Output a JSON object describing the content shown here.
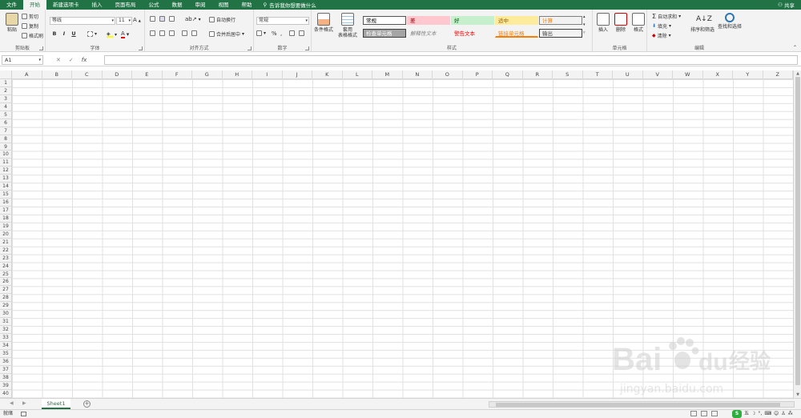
{
  "tabs": [
    "文件",
    "开始",
    "新建选项卡",
    "插入",
    "页面布局",
    "公式",
    "数据",
    "审阅",
    "视图",
    "帮助"
  ],
  "active_tab": "开始",
  "tellme": "告诉我你想要做什么",
  "share": "共享",
  "clipboard": {
    "paste": "粘贴",
    "cut": "剪切",
    "copy": "复制",
    "painter": "格式刷",
    "label": "剪贴板"
  },
  "font": {
    "name": "等线",
    "size": "11",
    "bold": "B",
    "italic": "I",
    "underline": "U",
    "label": "字体"
  },
  "alignment": {
    "wrap": "自动换行",
    "merge": "合并后居中",
    "label": "对齐方式"
  },
  "number": {
    "format": "常规",
    "percent": "%",
    "label": "数字"
  },
  "styles": {
    "conditional": "条件格式",
    "table": "套用\n表格格式",
    "cells": [
      {
        "text": "常规",
        "bg": "#ffffff",
        "fg": "#000000",
        "border": "#555555"
      },
      {
        "text": "差",
        "bg": "#ffc7ce",
        "fg": "#9c0006",
        "border": "#ffc7ce"
      },
      {
        "text": "好",
        "bg": "#c6efce",
        "fg": "#006100",
        "border": "#c6efce"
      },
      {
        "text": "适中",
        "bg": "#ffeb9c",
        "fg": "#9c5700",
        "border": "#ffeb9c"
      },
      {
        "text": "计算",
        "bg": "#f2f2f2",
        "fg": "#fa7d00",
        "border": "#7f7f7f"
      },
      {
        "text": "检查单元格",
        "bg": "#a5a5a5",
        "fg": "#ffffff",
        "border": "#3f3f3f"
      },
      {
        "text": "解释性文本",
        "bg": "#f3f3f3",
        "fg": "#7f7f7f",
        "border": "#f3f3f3"
      },
      {
        "text": "警告文本",
        "bg": "#f3f3f3",
        "fg": "#ff0000",
        "border": "#f3f3f3"
      },
      {
        "text": "链接单元格",
        "bg": "#f3f3f3",
        "fg": "#fa7d00",
        "border": "#f3f3f3"
      },
      {
        "text": "输出",
        "bg": "#f2f2f2",
        "fg": "#3f3f3f",
        "border": "#3f3f3f"
      }
    ],
    "label": "样式"
  },
  "cells_group": {
    "insert": "插入",
    "delete": "删除",
    "format": "格式",
    "label": "单元格"
  },
  "editing": {
    "autosum": "自动求和",
    "fill": "填充",
    "clear": "清除",
    "sort": "排序和筛选",
    "find": "查找和选择",
    "label": "编辑"
  },
  "namebox": "A1",
  "fx": "fx",
  "columns": [
    "A",
    "B",
    "C",
    "D",
    "E",
    "F",
    "G",
    "H",
    "I",
    "J",
    "K",
    "L",
    "M",
    "N",
    "O",
    "P",
    "Q",
    "R",
    "S",
    "T",
    "U",
    "V",
    "W",
    "X",
    "Y",
    "Z"
  ],
  "rows": [
    1,
    2,
    3,
    4,
    5,
    6,
    7,
    8,
    9,
    10,
    11,
    12,
    13,
    14,
    15,
    16,
    17,
    18,
    19,
    20,
    21,
    22,
    23,
    24,
    25,
    26,
    27,
    28,
    29,
    30,
    31,
    32,
    33,
    34,
    35,
    36,
    37,
    38,
    39,
    40
  ],
  "sheet_tab": "Sheet1",
  "status": "就绪",
  "watermark": {
    "brand": "Bai",
    "brand2": "du",
    "cn": "经验",
    "url": "jingyan.baidu.com"
  },
  "tray": {
    "ime": "五"
  },
  "accent": "#217346"
}
